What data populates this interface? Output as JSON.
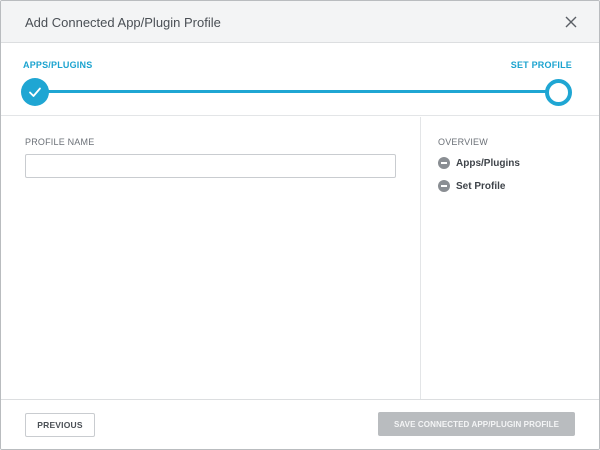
{
  "dialog": {
    "title": "Add Connected App/Plugin Profile"
  },
  "stepper": {
    "steps": [
      {
        "label": "APPS/PLUGINS",
        "state": "complete"
      },
      {
        "label": "SET PROFILE",
        "state": "current"
      }
    ],
    "accent_color": "#1fa6d3"
  },
  "form": {
    "profile_name_label": "PROFILE NAME",
    "profile_name_value": "",
    "profile_name_placeholder": ""
  },
  "overview": {
    "title": "OVERVIEW",
    "items": [
      {
        "label": "Apps/Plugins",
        "icon": "minus-circle-icon"
      },
      {
        "label": "Set Profile",
        "icon": "minus-circle-icon"
      }
    ]
  },
  "footer": {
    "previous_label": "PREVIOUS",
    "save_label": "SAVE CONNECTED APP/PLUGIN PROFILE"
  }
}
